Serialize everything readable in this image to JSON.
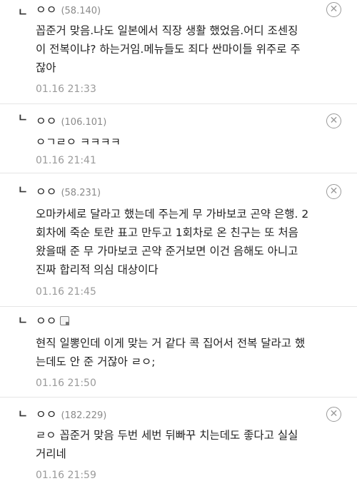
{
  "comments": [
    {
      "author": "ㅇㅇ",
      "ip": "(58.140)",
      "text": "꼽준거 맞음.나도 일본에서 직장 생활 했었음.어디 조센징\n이 전복이냐? 하는거임.메뉴들도 죄다 싼마이들 위주로 주\n잖아",
      "time": "01.16 21:33",
      "has_memo_icon": false
    },
    {
      "author": "ㅇㅇ",
      "ip": "(106.101)",
      "text": "ㅇㄱㄹㅇ ㅋㅋㅋㅋ",
      "time": "01.16 21:41",
      "has_memo_icon": false
    },
    {
      "author": "ㅇㅇ",
      "ip": "(58.231)",
      "text": "오마카세로 달라고 했는데 주는게 무 가바보코 곤약 은행. 2\n회차에 죽순 토란 표고 만두고 1회차로 온 친구는 또 처음\n왔을때 준 무 가마보코 곤약 준거보면 이건 음해도 아니고\n진짜 합리적 의심 대상이다",
      "time": "01.16 21:45",
      "has_memo_icon": false
    },
    {
      "author": "ㅇㅇ",
      "ip": "",
      "text": "현직 일뽕인데 이게 맞는 거 같다 콕 집어서 전복 달라고 했\n는데도 안 준 거잖아 ㄹㅇ;",
      "time": "01.16 21:50",
      "has_memo_icon": true
    },
    {
      "author": "ㅇㅇ",
      "ip": "(182.229)",
      "text": "ㄹㅇ 꼽준거 맞음 두번 세번 뒤빠꾸 치는데도 좋다고 실실\n거리네",
      "time": "01.16 21:59",
      "has_memo_icon": false
    }
  ],
  "labels": {
    "reply_mark": "ㄴ",
    "delete": "✕"
  },
  "icons": {
    "delete": "close-circle-icon",
    "reply": "reply-arrow-icon",
    "memo": "memo-icon"
  },
  "colors": {
    "ip": "#8a8a8a",
    "time": "#9a9a9a",
    "divider": "#e6e6e6"
  }
}
